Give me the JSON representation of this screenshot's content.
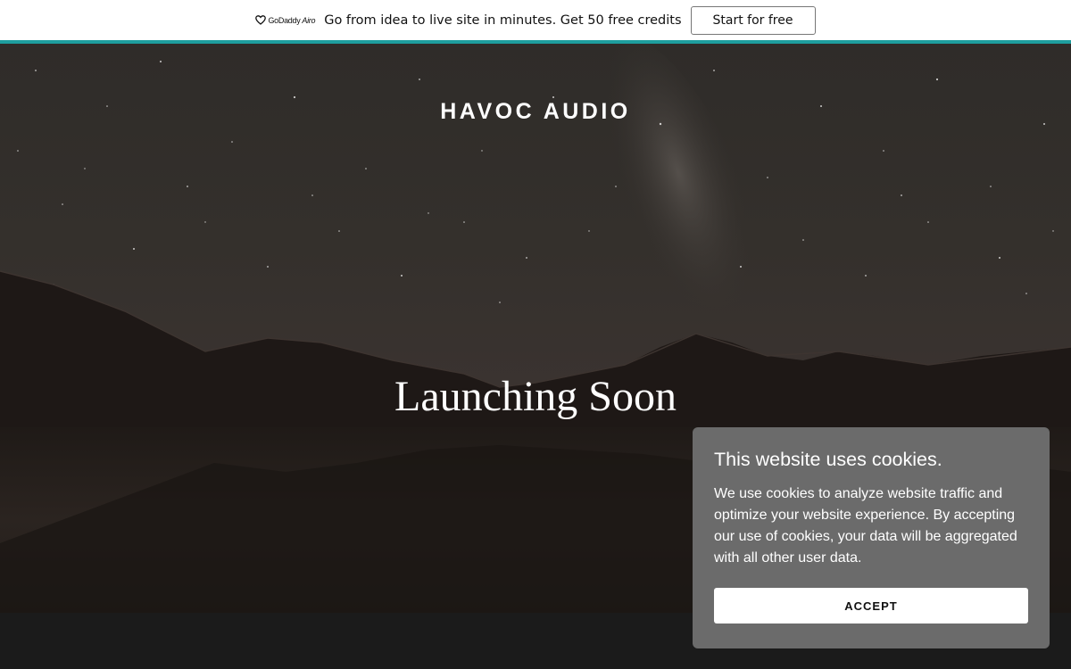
{
  "promo": {
    "brand_name": "GoDaddy",
    "brand_product": "Airo",
    "text": "Go from idea to live site in minutes. Get 50 free credits",
    "cta_label": "Start for free",
    "accent_color": "#1e9e9e"
  },
  "site": {
    "title": "HAVOC AUDIO",
    "headline": "Launching Soon"
  },
  "cookie_banner": {
    "title": "This website uses cookies.",
    "body": "We use cookies to analyze website traffic and optimize your website experience. By accepting our use of cookies, your data will be aggregated with all other user data.",
    "accept_label": "ACCEPT",
    "background_color": "#6b6b6b"
  }
}
